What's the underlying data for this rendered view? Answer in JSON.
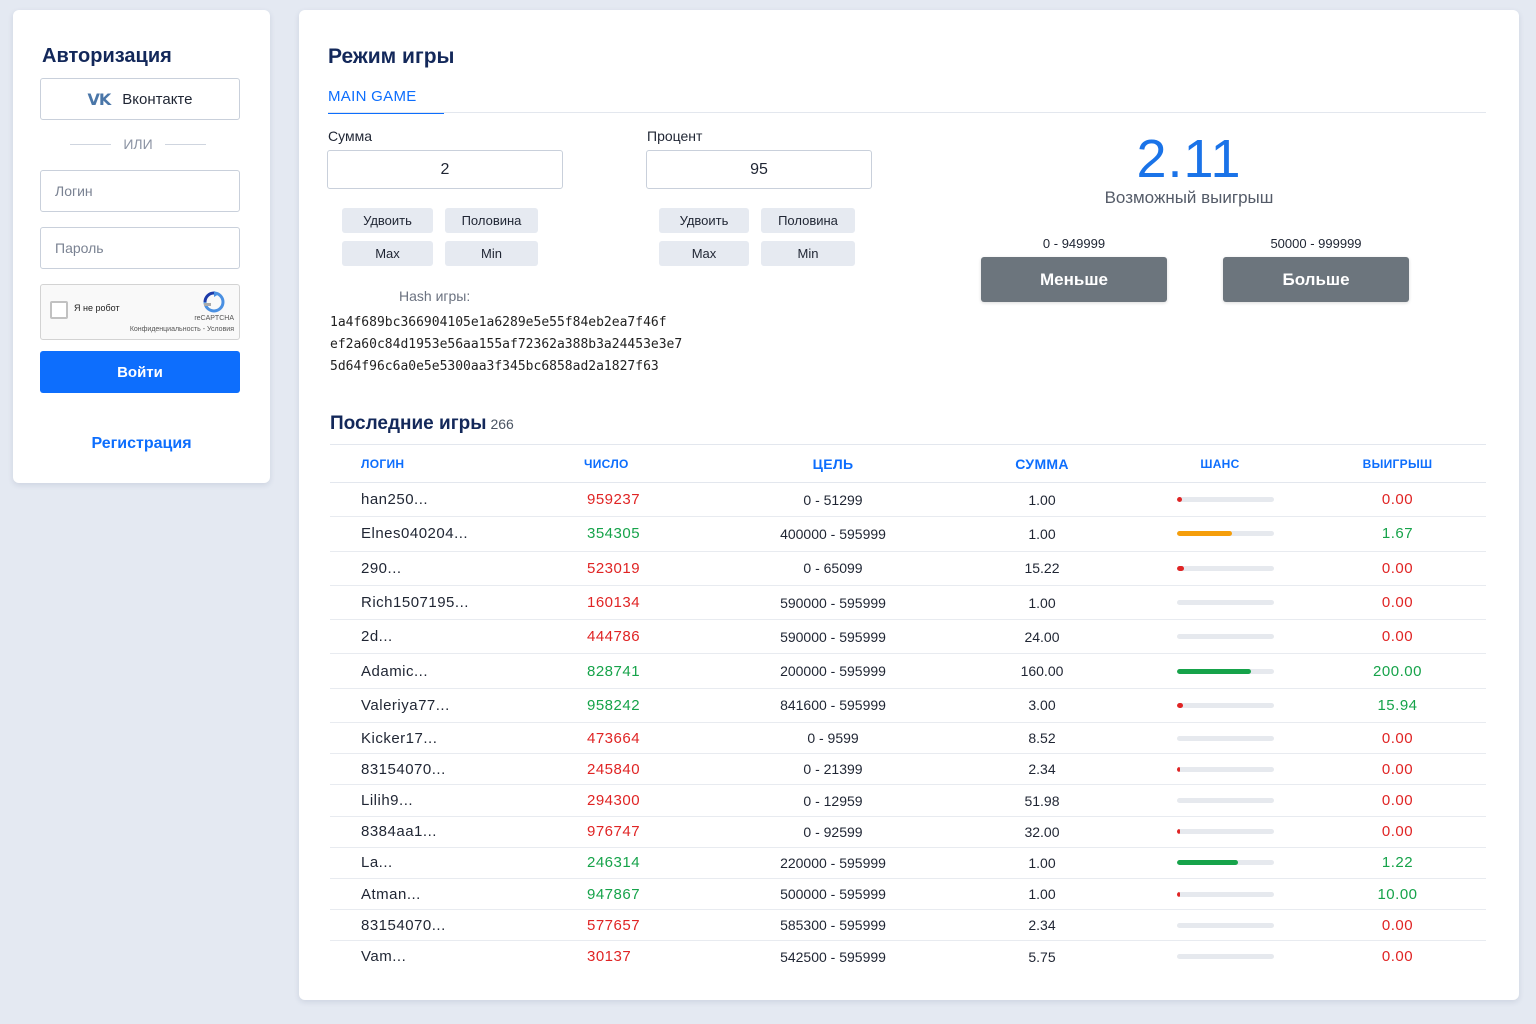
{
  "auth": {
    "title": "Авторизация",
    "vk_label": "Вконтакте",
    "or_label": "ИЛИ",
    "login_placeholder": "Логин",
    "password_placeholder": "Пароль",
    "captcha_label": "Я не робот",
    "captcha_brand": "reCAPTCHA",
    "captcha_links": "Конфиденциальность - Условия",
    "login_button": "Войти",
    "register_link": "Регистрация"
  },
  "main": {
    "title": "Режим игры",
    "tab": "MAIN GAME",
    "sum_label": "Сумма",
    "sum_value": "2",
    "percent_label": "Процент",
    "percent_value": "95",
    "double_label": "Удвоить",
    "half_label": "Половина",
    "max_label": "Max",
    "min_label": "Min",
    "hash_label": "Hash игры:",
    "hash_lines": [
      "1a4f689bc366904105e1a6289e5e55f84eb2ea7f46f",
      "ef2a60c84d1953e56aa155af72362a388b3a24453e3e7",
      "5d64f96c6a0e5e5300aa3f345bc6858ad2a1827f63"
    ],
    "payout": "2.11",
    "payout_label": "Возможный выигрыш",
    "less_range": "0 - 949999",
    "more_range": "50000 - 999999",
    "less_button": "Меньше",
    "more_button": "Больше"
  },
  "recent": {
    "title": "Последние игры",
    "count": "266",
    "columns": [
      "Логин",
      "Число",
      "Цель",
      "Сумма",
      "Шанс",
      "Выигрыш"
    ],
    "rows": [
      {
        "login": "han250...",
        "number": "959237",
        "target": "0 - 51299",
        "sum": "1.00",
        "chance": 0.05,
        "chance_color": "#e02424",
        "win": "0.00",
        "won": false
      },
      {
        "login": "Elnes040204...",
        "number": "354305",
        "target": "400000 - 595999",
        "sum": "1.00",
        "chance": 0.57,
        "chance_color": "#f59e0b",
        "win": "1.67",
        "won": true
      },
      {
        "login": "290...",
        "number": "523019",
        "target": "0 - 65099",
        "sum": "15.22",
        "chance": 0.07,
        "chance_color": "#e02424",
        "win": "0.00",
        "won": false
      },
      {
        "login": "Rich1507195...",
        "number": "160134",
        "target": "590000 - 595999",
        "sum": "1.00",
        "chance": 0.0,
        "chance_color": "#e02424",
        "win": "0.00",
        "won": false
      },
      {
        "login": "2d...",
        "number": "444786",
        "target": "590000 - 595999",
        "sum": "24.00",
        "chance": 0.0,
        "chance_color": "#e02424",
        "win": "0.00",
        "won": false
      },
      {
        "login": "Adamic...",
        "number": "828741",
        "target": "200000 - 595999",
        "sum": "160.00",
        "chance": 0.76,
        "chance_color": "#16a34a",
        "win": "200.00",
        "won": true
      },
      {
        "login": "Valeriya77...",
        "number": "958242",
        "target": "841600 - 595999",
        "sum": "3.00",
        "chance": 0.06,
        "chance_color": "#e02424",
        "win": "15.94",
        "won": true
      },
      {
        "login": "Kicker17...",
        "number": "473664",
        "target": "0 - 9599",
        "sum": "8.52",
        "chance": 0.0,
        "chance_color": "#e02424",
        "win": "0.00",
        "won": false
      },
      {
        "login": "83154070...",
        "number": "245840",
        "target": "0 - 21399",
        "sum": "2.34",
        "chance": 0.02,
        "chance_color": "#e02424",
        "win": "0.00",
        "won": false
      },
      {
        "login": "Lilih9...",
        "number": "294300",
        "target": "0 - 12959",
        "sum": "51.98",
        "chance": 0.0,
        "chance_color": "#e02424",
        "win": "0.00",
        "won": false
      },
      {
        "login": "8384aa1...",
        "number": "976747",
        "target": "0 - 92599",
        "sum": "32.00",
        "chance": 0.02,
        "chance_color": "#e02424",
        "win": "0.00",
        "won": false
      },
      {
        "login": "La...",
        "number": "246314",
        "target": "220000 - 595999",
        "sum": "1.00",
        "chance": 0.63,
        "chance_color": "#16a34a",
        "win": "1.22",
        "won": true
      },
      {
        "login": "Atman...",
        "number": "947867",
        "target": "500000 - 595999",
        "sum": "1.00",
        "chance": 0.02,
        "chance_color": "#e02424",
        "win": "10.00",
        "won": true
      },
      {
        "login": "83154070...",
        "number": "577657",
        "target": "585300 - 595999",
        "sum": "2.34",
        "chance": 0.0,
        "chance_color": "#e02424",
        "win": "0.00",
        "won": false
      },
      {
        "login": "Vam...",
        "number": "30137",
        "target": "542500 - 595999",
        "sum": "5.75",
        "chance": 0.0,
        "chance_color": "#e02424",
        "win": "0.00",
        "won": false
      }
    ]
  }
}
